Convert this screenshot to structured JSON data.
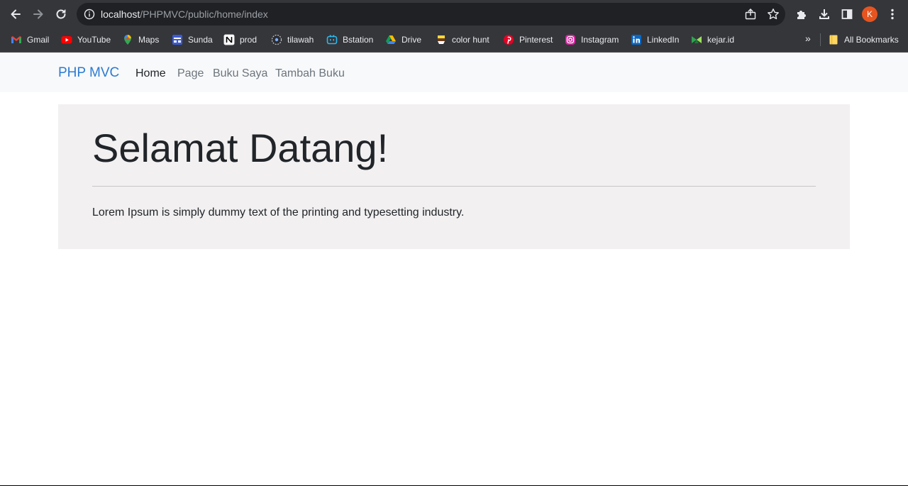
{
  "browser": {
    "url_host": "localhost",
    "url_path": "/PHPMVC/public/home/index",
    "profile_initial": "K",
    "icons": {
      "back": "back-arrow-icon",
      "forward": "forward-arrow-icon",
      "reload": "reload-icon",
      "site_info": "info-icon",
      "share": "share-icon",
      "bookmark_star": "star-icon",
      "extensions": "puzzle-icon",
      "downloads": "download-icon",
      "side_panel": "side-panel-icon",
      "menu": "kebab-menu-icon"
    },
    "bookmarks": [
      {
        "label": "Gmail",
        "icon": "gmail-icon"
      },
      {
        "label": "YouTube",
        "icon": "youtube-icon"
      },
      {
        "label": "Maps",
        "icon": "maps-icon"
      },
      {
        "label": "Sunda",
        "icon": "calendar-icon"
      },
      {
        "label": "prod",
        "icon": "notion-icon"
      },
      {
        "label": "tilawah",
        "icon": "globe-icon"
      },
      {
        "label": "Bstation",
        "icon": "tv-icon"
      },
      {
        "label": "Drive",
        "icon": "drive-icon"
      },
      {
        "label": "color hunt",
        "icon": "colorhunt-icon"
      },
      {
        "label": "Pinterest",
        "icon": "pinterest-icon"
      },
      {
        "label": "Instagram",
        "icon": "instagram-icon"
      },
      {
        "label": "LinkedIn",
        "icon": "linkedin-icon"
      },
      {
        "label": "kejar.id",
        "icon": "kejar-icon"
      }
    ],
    "overflow_label": "»",
    "all_bookmarks_label": "All Bookmarks"
  },
  "navbar": {
    "brand": "PHP MVC",
    "links": [
      {
        "label": "Home",
        "active": true
      },
      {
        "label": "Page",
        "active": false
      },
      {
        "label": "Buku Saya",
        "active": false
      },
      {
        "label": "Tambah Buku",
        "active": false
      }
    ]
  },
  "jumbotron": {
    "title": "Selamat Datang!",
    "lead": "Lorem Ipsum is simply dummy text of the printing and typesetting industry."
  },
  "colors": {
    "chrome_bg": "#35363a",
    "omnibox_bg": "#202124",
    "navbar_bg": "#f8f9fa",
    "brand": "#2b7bd3",
    "jumbotron_bg": "#f2f0f1",
    "avatar_bg": "#e8541f"
  }
}
